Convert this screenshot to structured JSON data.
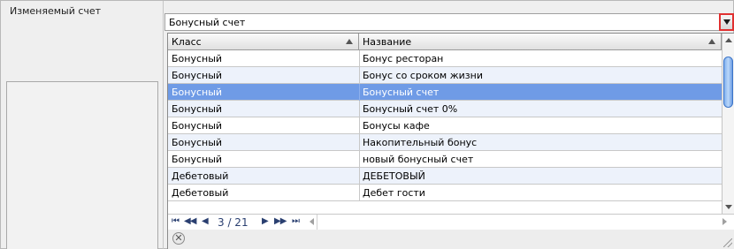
{
  "form": {
    "field_label": "Изменяемый счет",
    "combo_value": "Бонусный счет"
  },
  "grid": {
    "columns": [
      "Класс",
      "Название"
    ],
    "rows": [
      {
        "class": "Бонусный",
        "name": "Бонус ресторан"
      },
      {
        "class": "Бонусный",
        "name": "Бонус со сроком жизни"
      },
      {
        "class": "Бонусный",
        "name": "Бонусный счет",
        "selected": true
      },
      {
        "class": "Бонусный",
        "name": "Бонусный счет 0%"
      },
      {
        "class": "Бонусный",
        "name": "Бонусы кафе"
      },
      {
        "class": "Бонусный",
        "name": "Накопительный бонус"
      },
      {
        "class": "Бонусный",
        "name": "новый бонусный счет"
      },
      {
        "class": "Дебетовый",
        "name": "ДЕБЕТОВЫЙ"
      },
      {
        "class": "Дебетовый",
        "name": "Дебет гости"
      }
    ]
  },
  "pager": {
    "first": "⏮",
    "prev_block": "◀◀",
    "prev": "◀",
    "page_text": "3 / 21",
    "next": "▶",
    "next_block": "▶▶",
    "last": "⏭"
  },
  "icons": {
    "dropdown": "chevron-down-icon",
    "clear": "clear-icon"
  },
  "colors": {
    "selected_row": "#6f9be6",
    "alt_row": "#edf2fb",
    "highlight_border": "#e03030"
  }
}
